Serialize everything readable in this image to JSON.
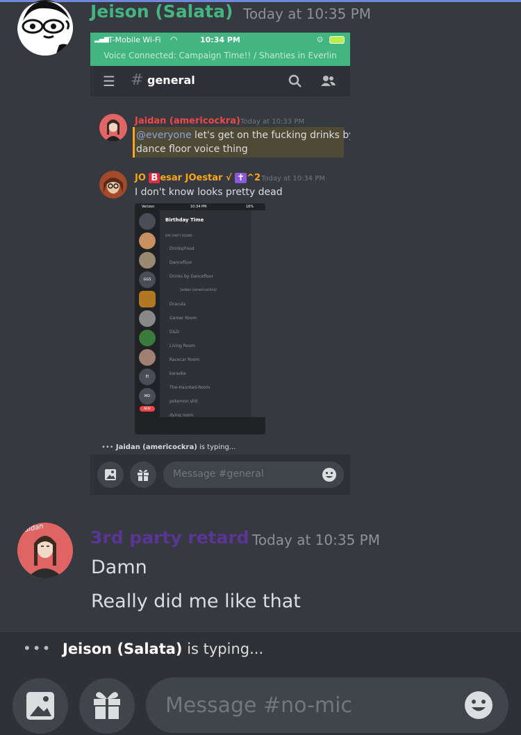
{
  "message1": {
    "author": "Jeison (Salata)",
    "author_color": "#43b581",
    "time": "Today at 10:35 PM"
  },
  "screenshot": {
    "status": {
      "carrier": "T-Mobile Wi-Fi",
      "clock": "10:34 PM"
    },
    "voice_banner": "Voice Connected: Campaign Time!! / Shanties in Everlin",
    "channel": "general",
    "msg1": {
      "author": "Jaidan (americockra)",
      "time": "Today at 10:33 PM",
      "mention": "@everyone",
      "text_line1": " let's get on the fucking drinks by",
      "text_line2": "dance floor voice thing"
    },
    "msg2": {
      "author_prefix": "JO",
      "author_badge": "B",
      "author_suffix": "esar JOestar √",
      "author_cross": "✝",
      "author_end": "^2",
      "time": "Today at 10:34 PM",
      "text": "I don't know looks pretty dead"
    },
    "phone": {
      "carrier": "Verizon",
      "clock": "10:34 PM",
      "battery": "16%",
      "server": "Birthday Time",
      "category": "EPIC PARTY ROOMS",
      "channels": [
        "Drinks/Food",
        "Dancefloor",
        "Drinks by Dancefloor",
        "Dracula",
        "Gamer Room",
        "D&D",
        "Living Room",
        "Racecar Room",
        "karaoke",
        "The-Haunted-Room",
        "pokemon shit",
        "dying room"
      ],
      "voice_user": "Jaidan (americockra)",
      "rail_labels": [
        "GGS",
        "EI",
        "MD"
      ],
      "new_badge": "NEW"
    },
    "typing_user": "Jaidan (americockra)",
    "typing_suffix": " is typing...",
    "input_placeholder": "Message #general"
  },
  "message2": {
    "author": "3rd party retard",
    "author_color": "#593695",
    "time": "Today at 10:35 PM",
    "avatar_text": "Jaidan",
    "lines": [
      "Damn",
      "Really did me like that"
    ]
  },
  "typing": {
    "user": "Jeison (Salata)",
    "suffix": " is typing..."
  },
  "compose": {
    "placeholder": "Message #no-mic"
  },
  "icons": [
    "image-icon",
    "gift-icon",
    "emoji-icon",
    "hamburger-icon",
    "hash-icon",
    "search-icon",
    "members-icon"
  ]
}
